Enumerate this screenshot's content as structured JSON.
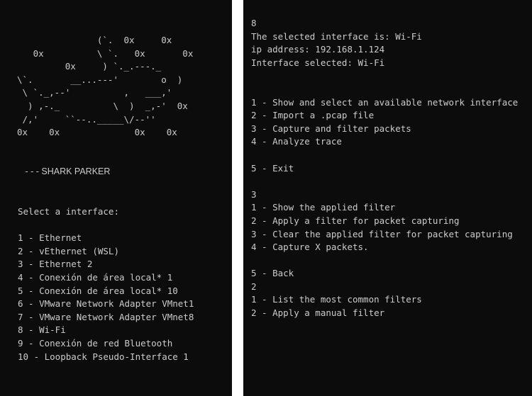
{
  "left": {
    "ascii_art": "               (`.  0x     0x\n   0x          \\ `.   0x       0x\n         0x     ) `._.---._\n\\`.       __...---'        o  )\n \\ `._,--'          ,   ___,'\n  ) ,-._          \\  )  _,-'  0x\n /,'     ``--.._____\\/--''\n0x    0x              0x    0x",
    "title": " - - - SHARK PARKER",
    "prompt": "Select a interface:",
    "interfaces": [
      "1 - Ethernet",
      "2 - vEthernet (WSL)",
      "3 - Ethernet 2",
      "4 - Conexión de área local* 1",
      "5 - Conexión de área local* 10",
      "6 - VMware Network Adapter VMnet1",
      "7 - VMware Network Adapter VMnet8",
      "8 - Wi-Fi",
      "9 - Conexión de red Bluetooth",
      "10 - Loopback Pseudo-Interface 1"
    ]
  },
  "right": {
    "input_1": "8",
    "selected_line": "The selected interface is: Wi-Fi",
    "ip_line": "ip address: 192.168.1.124",
    "iface_line": "Interface selected: Wi-Fi",
    "main_menu": [
      "1 - Show and select an available network interface",
      "2 - Import a .pcap file",
      "3 - Capture and filter packets",
      "4 - Analyze trace"
    ],
    "exit": "5 - Exit",
    "input_2": "3",
    "capture_menu": [
      "1 - Show the applied filter",
      "2 - Apply a filter for packet capturing",
      "3 - Clear the applied filter for packet capturing",
      "4 - Capture X packets."
    ],
    "back": "5 - Back",
    "input_3": "2",
    "filter_menu": [
      "1 - List the most common filters",
      "2 - Apply a manual filter"
    ]
  },
  "colors": {
    "terminal_bg": "#0c0c0c",
    "terminal_fg": "#cccccc",
    "gap": "#ffffff"
  }
}
